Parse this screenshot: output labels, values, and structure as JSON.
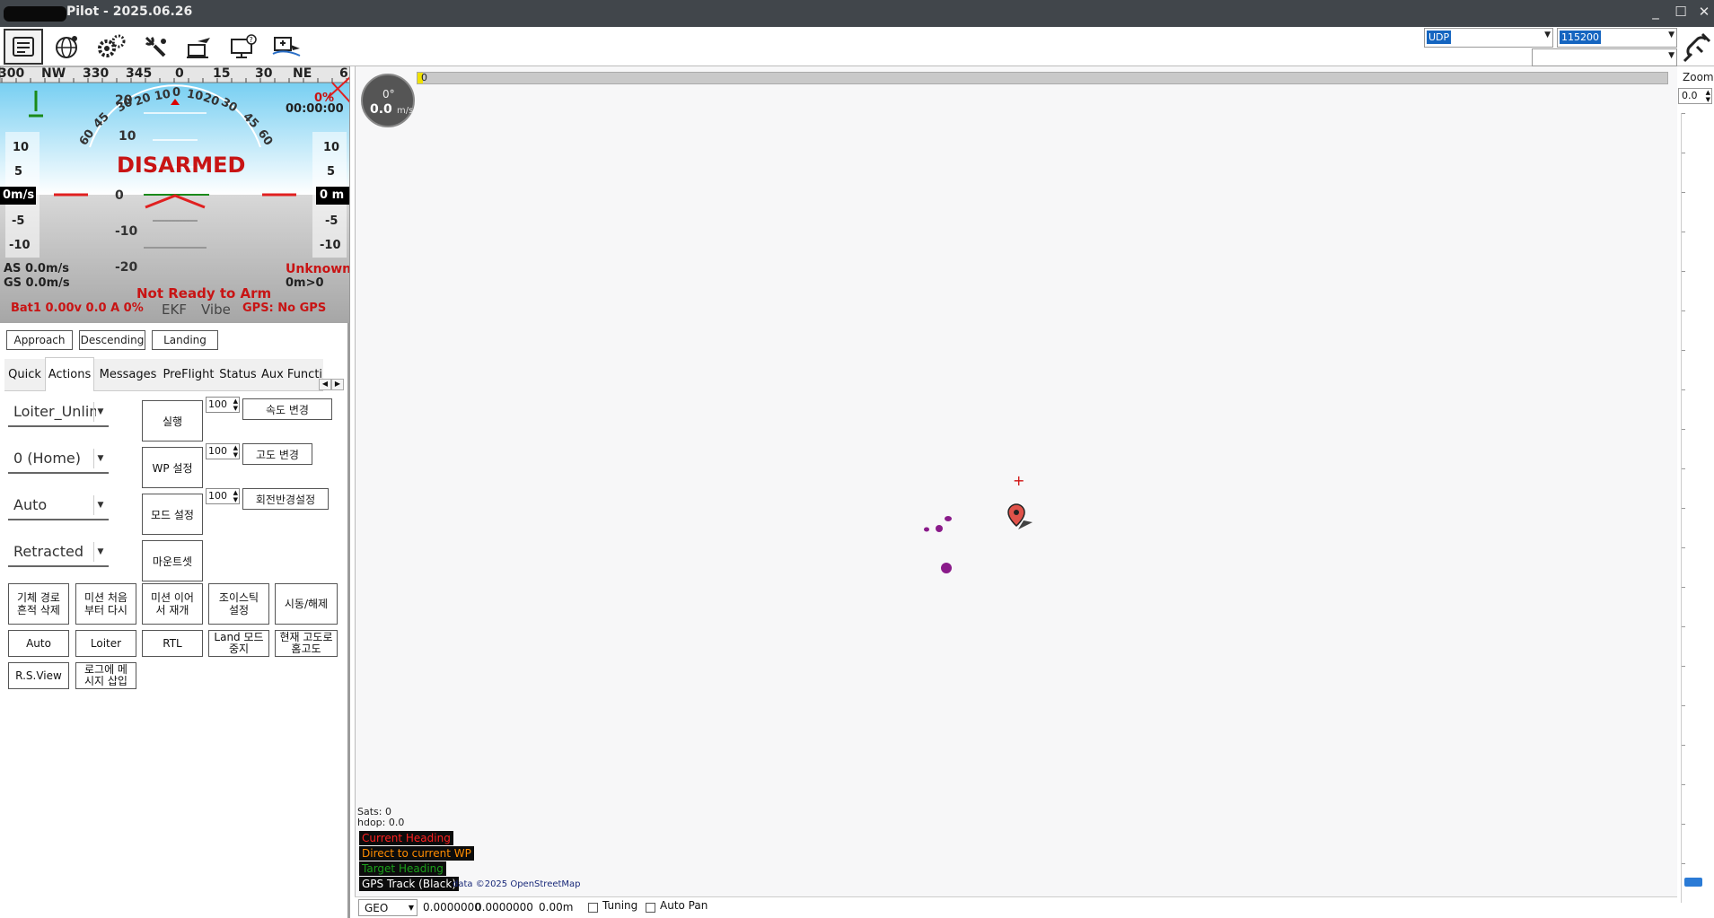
{
  "window": {
    "title": "Pilot - 2025.06.26",
    "minimize": "_",
    "maximize": "☐",
    "close": "✕"
  },
  "toolbar": {
    "buttons": [
      "flight-data",
      "flight-plan",
      "initial-setup",
      "config-tuning",
      "simulation",
      "help",
      "donate"
    ],
    "connection_type": "UDP",
    "baud_rate": "115200"
  },
  "hud": {
    "compass_labels": [
      "300",
      "NW",
      "330",
      "345",
      "0",
      "15",
      "30",
      "NE",
      "6"
    ],
    "pitch_labels": [
      "20",
      "10",
      "0",
      "-10",
      "-20"
    ],
    "roll_labels": [
      "60",
      "45",
      "30",
      "20",
      "10",
      "0",
      "10",
      "20",
      "30",
      "45",
      "60"
    ],
    "speed_scale": [
      "10",
      "5",
      "0m/s",
      "-5",
      "-10"
    ],
    "alt_scale": [
      "10",
      "5",
      "0 m",
      "-5",
      "-10"
    ],
    "status": "DISARMED",
    "timer": "00:00:00",
    "throttle_pct": "0%",
    "airspeed": "AS 0.0m/s",
    "groundspeed": "GS 0.0m/s",
    "mode": "Unknown",
    "wp_dist": "0m>0",
    "arm_msg": "Not Ready to Arm",
    "battery": "Bat1 0.00v 0.0 A 0%",
    "ekf": "EKF",
    "vibe": "Vibe",
    "gps": "GPS: No GPS"
  },
  "panel": {
    "phase_buttons": [
      "Approach",
      "Descending",
      "Landing"
    ],
    "tabs": [
      "Quick",
      "Actions",
      "Messages",
      "PreFlight",
      "Status",
      "Aux Functi"
    ],
    "active_tab": "Actions",
    "dropdowns": [
      "Loiter_Unlim",
      "0 (Home)",
      "Auto",
      "Retracted"
    ],
    "action_buttons": [
      "실행",
      "WP 설정",
      "모드 설정",
      "마운트셋"
    ],
    "spin_values": [
      "100",
      "100",
      "100"
    ],
    "spin_buttons": [
      "속도 변경",
      "고도 변경",
      "회전반경설정"
    ],
    "grid_row1": [
      "기체 경로\n흔적 삭제",
      "미션 처음\n부터 다시",
      "미션 이어\n서 재개",
      "조이스틱\n설정",
      "시동/해제"
    ],
    "grid_row2": [
      "Auto",
      "Loiter",
      "RTL",
      "Land 모드\n중지",
      "현재 고도로\n홈고도"
    ],
    "grid_row3": [
      "R.S.View",
      "로그에 메\n시지 삽입"
    ]
  },
  "map": {
    "heading_deg": "0°",
    "speed": "0.0",
    "speed_unit": "m/s",
    "progress_label": "0",
    "sats": "Sats: 0",
    "hdop": "hdop: 0.0",
    "legend": [
      {
        "text": "Current Heading",
        "color": "#ff2020"
      },
      {
        "text": "Direct to current WP",
        "color": "#ff8c00"
      },
      {
        "text": "Target Heading",
        "color": "#1aa01a"
      },
      {
        "text": "GPS Track (Black)",
        "color": "#ffffff"
      }
    ],
    "attribution": "data ©2025 OpenStreetMap"
  },
  "right": {
    "zoom_label": "Zoom",
    "zoom_value": "0.0"
  },
  "statusbar": {
    "coord_system": "GEO",
    "lat": "0.0000000",
    "lng": "0.0000000",
    "alt": "0.00m",
    "tuning": "Tuning",
    "autopan": "Auto Pan"
  }
}
